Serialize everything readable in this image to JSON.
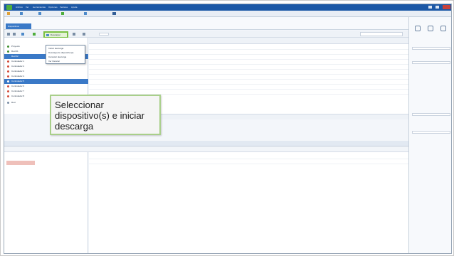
{
  "window": {
    "menus": [
      "Archivo",
      "Ver",
      "Herramientas",
      "Opciones",
      "Ventana",
      "Ayuda"
    ],
    "doc_tab": "Dispositivos"
  },
  "toolbar": {
    "dropdown_label": "Descargar"
  },
  "dropdown_menu": {
    "items": [
      "Iniciar descarga",
      "Descarga de dispositivo(s)",
      "Cancelar descarga",
      "Ver historial"
    ]
  },
  "tree": {
    "items": [
      {
        "label": "Proyecto",
        "color": "#3f8f2e"
      },
      {
        "label": "Red 01",
        "color": "#3f8f2e"
      },
      {
        "label": "Red 02",
        "color": "#3a79c7"
      },
      {
        "label": "Controlador 1",
        "color": "#d24b3a"
      },
      {
        "label": "Controlador 2",
        "color": "#d24b3a"
      },
      {
        "label": "Controlador 3",
        "color": "#d24b3a"
      },
      {
        "label": "Controlador 4",
        "color": "#d24b3a"
      },
      {
        "label": "Controlador 5",
        "color": "#ffffff"
      },
      {
        "label": "Controlador 6",
        "color": "#d24b3a"
      },
      {
        "label": "Controlador 7",
        "color": "#d24b3a"
      },
      {
        "label": "Controlador 8",
        "color": "#d24b3a"
      },
      {
        "label": "Red",
        "color": "#7a8ea5"
      }
    ]
  },
  "callout": {
    "text": "Seleccionar dispositivo(s) e iniciar descarga"
  },
  "colors": {
    "accent_green": "#7ac143",
    "title_blue": "#1c58a6",
    "selection_blue": "#3a79c7"
  }
}
